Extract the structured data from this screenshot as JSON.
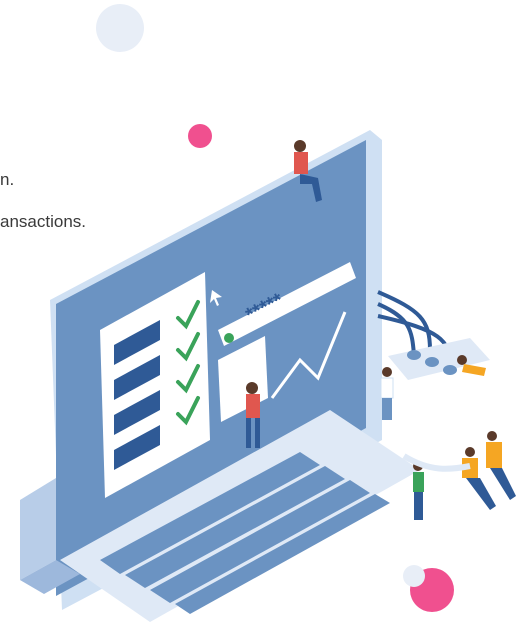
{
  "text": {
    "line1": "n.",
    "line2": "ansactions."
  },
  "illustration": {
    "password_text": "*****",
    "checklist_count": 4,
    "accent_colors": {
      "pink": "#f0508f",
      "light_blue": "#e6eef8",
      "mid_blue": "#6b93c2",
      "dark_blue": "#2f5a96",
      "check_green": "#3aa35a",
      "person_orange": "#f5a623",
      "person_red": "#e0574f"
    }
  }
}
